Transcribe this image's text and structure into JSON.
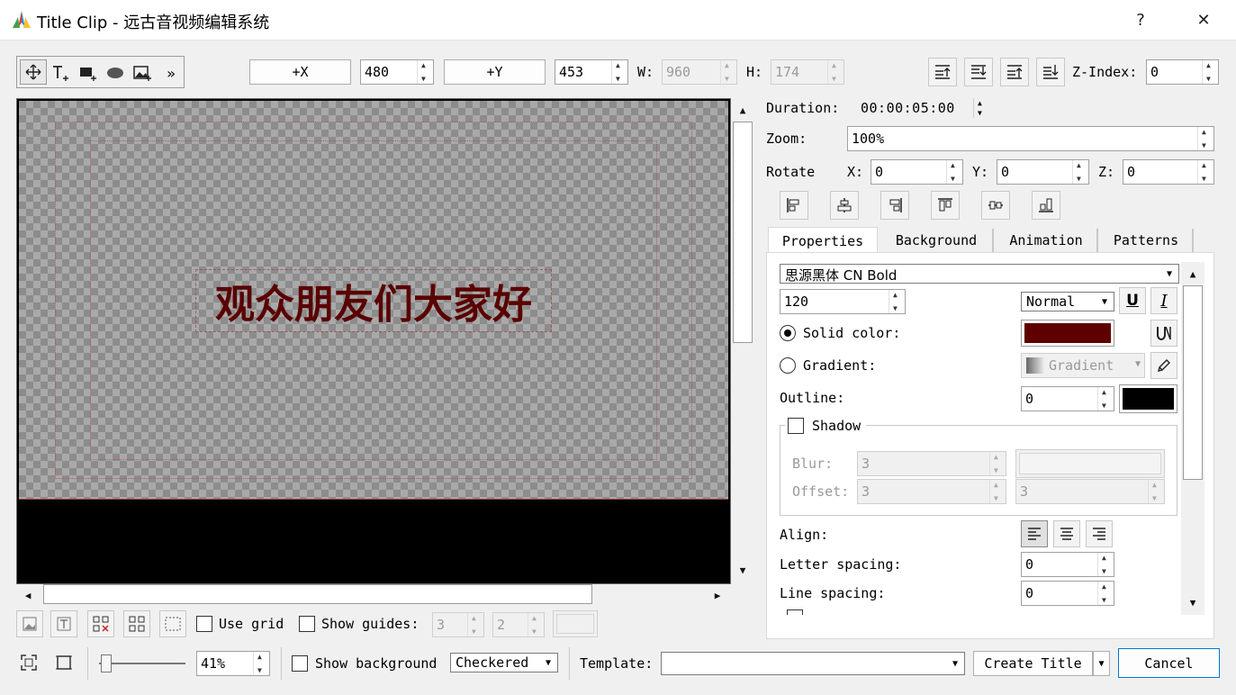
{
  "window": {
    "title": "Title Clip - 远古音视频编辑系统",
    "help": "?",
    "close": "✕"
  },
  "toolbar": {
    "more": "»",
    "x_button": "+X",
    "x_value": "480",
    "y_button": "+Y",
    "y_value": "453",
    "w_label": "W:",
    "w_value": "960",
    "h_label": "H:",
    "h_value": "174",
    "zindex_label": "Z-Index:",
    "zindex_value": "0"
  },
  "canvas": {
    "text": "观众朋友们大家好"
  },
  "props": {
    "duration_label": "Duration:",
    "duration_value": "00:00:05:00",
    "zoom_label": "Zoom:",
    "zoom_value": "100%",
    "rotate_label": "Rotate",
    "rx_label": "X:",
    "rx_value": "0",
    "ry_label": "Y:",
    "ry_value": "0",
    "rz_label": "Z:",
    "rz_value": "0"
  },
  "tabs": [
    "Properties",
    "Background",
    "Animation",
    "Patterns"
  ],
  "text_props": {
    "font": "思源黑体 CN Bold",
    "size": "120",
    "weight": "Normal",
    "underline": "U",
    "italic": "I",
    "solid_label": "Solid color:",
    "solid_color": "#5e0000",
    "gradient_label": "Gradient:",
    "gradient_value": "Gradient",
    "outline_label": "Outline:",
    "outline_value": "0",
    "outline_color": "#000000",
    "shadow_label": "Shadow",
    "blur_label": "Blur:",
    "blur_value": "3",
    "offset_label": "Offset:",
    "offset_x": "3",
    "offset_y": "3",
    "align_label": "Align:",
    "letter_label": "Letter spacing:",
    "letter_value": "0",
    "line_label": "Line spacing:",
    "line_value": "0"
  },
  "bottom": {
    "use_grid": "Use grid",
    "show_guides": "Show guides:",
    "guide_a": "3",
    "guide_b": "2",
    "zoom_value": "41%",
    "show_bg": "Show background",
    "bg_mode": "Checkered",
    "template_label": "Template:",
    "template_value": "",
    "create_title": "Create Title",
    "cancel": "Cancel"
  }
}
